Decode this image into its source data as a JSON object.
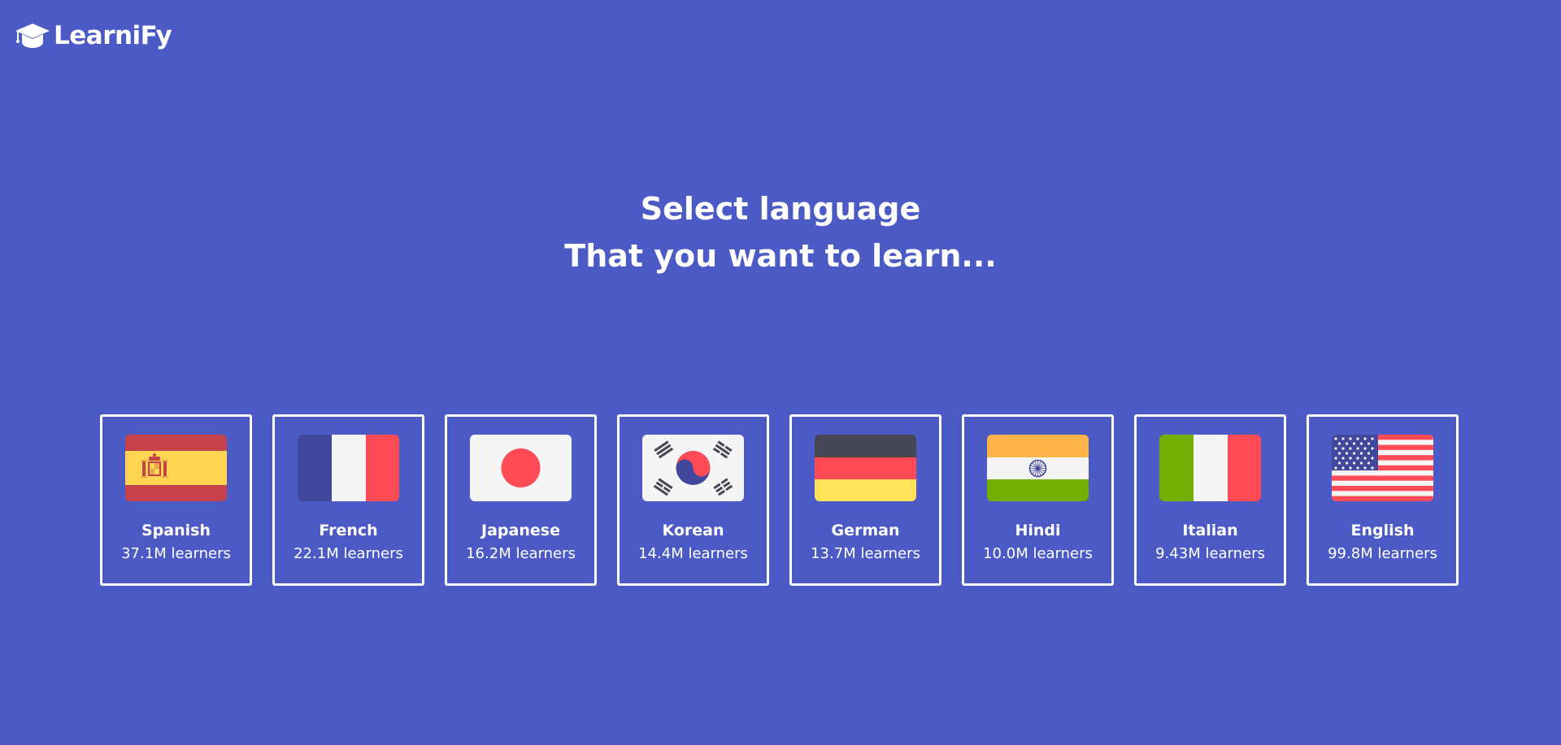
{
  "app": {
    "logo_text": "LearniFy",
    "logo_icon": "graduation-cap-icon"
  },
  "hero": {
    "title": "Select language",
    "subtitle": "That you want to learn..."
  },
  "colors": {
    "background": "#4b5ac4",
    "text": "#ffffff",
    "card_border": "#ffffff"
  },
  "languages": [
    {
      "name": "Spanish",
      "learners": "37.1M learners",
      "flag": "spain-flag-icon"
    },
    {
      "name": "French",
      "learners": "22.1M learners",
      "flag": "france-flag-icon"
    },
    {
      "name": "Japanese",
      "learners": "16.2M learners",
      "flag": "japan-flag-icon"
    },
    {
      "name": "Korean",
      "learners": "14.4M learners",
      "flag": "south-korea-flag-icon"
    },
    {
      "name": "German",
      "learners": "13.7M learners",
      "flag": "germany-flag-icon"
    },
    {
      "name": "Hindi",
      "learners": "10.0M learners",
      "flag": "india-flag-icon"
    },
    {
      "name": "Italian",
      "learners": "9.43M learners",
      "flag": "italy-flag-icon"
    },
    {
      "name": "English",
      "learners": "99.8M learners",
      "flag": "usa-flag-icon"
    }
  ]
}
